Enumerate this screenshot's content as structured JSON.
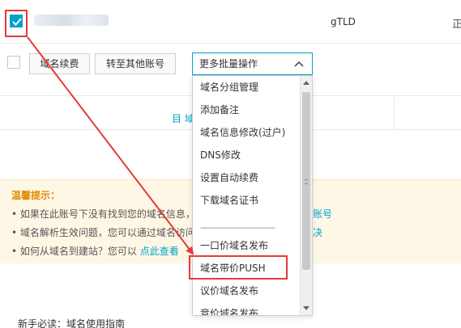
{
  "domain_row": {
    "tld": "gTLD",
    "edge_char": "正"
  },
  "toolbar": {
    "renew_label": "域名续费",
    "transfer_label": "转至其他账号",
    "more_label": "更多批量操作"
  },
  "middle": {
    "text": "目 域"
  },
  "tips": {
    "title": "温馨提示：",
    "line1": "• 如果在此账号下没有找到您的域名信息，",
    "line1_right": "录账号",
    "line2": "• 域名解析生效问题，您可以通过域名访问",
    "line2_right": "解决",
    "line3": "• 如何从域名到建站？您可以",
    "line3_link": "点此查看"
  },
  "dropdown": {
    "items": [
      "域名分组管理",
      "添加备注",
      "域名信息修改(过户)",
      "DNS修改",
      "设置自动续费",
      "下载域名证书",
      "一口价域名发布",
      "域名带价PUSH",
      "议价域名发布",
      "竞价域名发布"
    ],
    "separator": "-------------------------------"
  },
  "footer": {
    "text": "新手必读：域名使用指南"
  },
  "colors": {
    "accent": "#00a2ca",
    "highlight": "#e23b3b",
    "tips_bg": "#fff7e6"
  }
}
